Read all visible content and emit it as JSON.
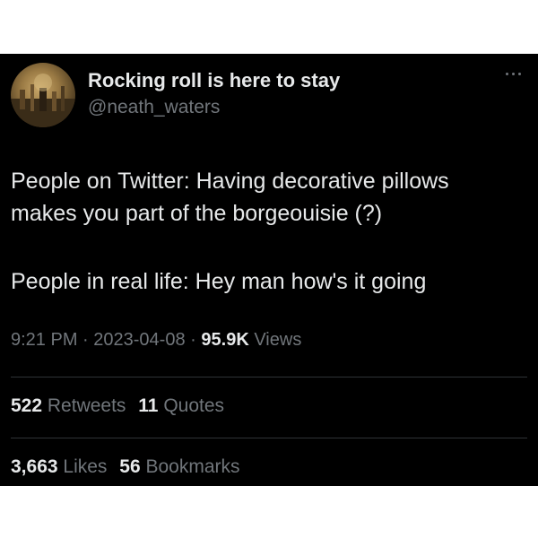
{
  "tweet": {
    "display_name": "Rocking roll is here to stay",
    "handle": "@neath_waters",
    "line1": "People on Twitter: Having decorative pillows",
    "line2": "makes you part of the borgeouisie (?)",
    "line3": "People in real life: Hey man how's it going",
    "time": "9:21 PM",
    "separator": "·",
    "date": "2023-04-08",
    "views_count": "95.9K",
    "views_label": "Views"
  },
  "stats": {
    "retweets_count": "522",
    "retweets_label": "Retweets",
    "quotes_count": "11",
    "quotes_label": "Quotes",
    "likes_count": "3,663",
    "likes_label": "Likes",
    "bookmarks_count": "56",
    "bookmarks_label": "Bookmarks"
  },
  "icons": {
    "more": "more-options-icon"
  },
  "colors": {
    "background": "#000000",
    "text_primary": "#e7e9ea",
    "text_secondary": "#71767b",
    "divider": "#2f3336"
  }
}
